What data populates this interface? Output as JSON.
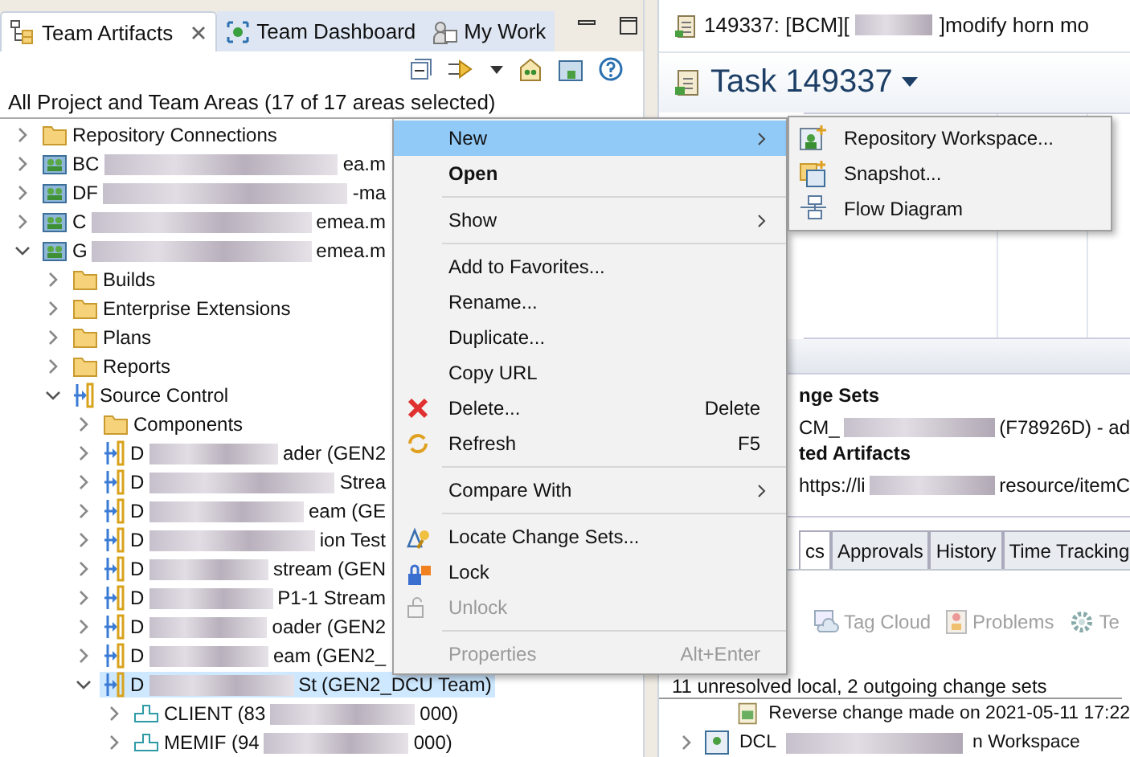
{
  "artifacts_view": {
    "tabs": [
      {
        "label": "Team Artifacts",
        "selected": true
      },
      {
        "label": "Team Dashboard",
        "selected": false
      },
      {
        "label": "My Work",
        "selected": false
      }
    ],
    "filter_label": "All Project and Team Areas (17 of 17 areas selected)",
    "tree": [
      {
        "kind": "folder",
        "label": "Repository Connections",
        "expanded": false,
        "selected": false,
        "blurred": false
      },
      {
        "kind": "project-area",
        "label": "BC",
        "label_end": "ea.m",
        "blurred": true,
        "expanded": false,
        "selected": false
      },
      {
        "kind": "project-area",
        "label": "DF",
        "label_end": "-ma",
        "blurred": true,
        "expanded": false,
        "selected": false
      },
      {
        "kind": "project-area",
        "label": "C",
        "label_end": "emea.m",
        "blurred": true,
        "expanded": false,
        "selected": false
      },
      {
        "kind": "project-area",
        "label": "G",
        "label_end": "emea.m",
        "blurred": true,
        "expanded": true,
        "selected": false,
        "children": [
          {
            "kind": "folder",
            "label": "Builds",
            "expanded": false,
            "selected": false,
            "blurred": false
          },
          {
            "kind": "folder",
            "label": "Enterprise Extensions",
            "expanded": false,
            "selected": false,
            "blurred": false
          },
          {
            "kind": "folder",
            "label": "Plans",
            "expanded": false,
            "selected": false,
            "blurred": false
          },
          {
            "kind": "folder",
            "label": "Reports",
            "expanded": false,
            "selected": false,
            "blurred": false
          },
          {
            "kind": "stream",
            "label": "Source Control",
            "expanded": true,
            "selected": false,
            "blurred": false,
            "children": [
              {
                "kind": "folder",
                "label": "Components",
                "expanded": false,
                "selected": false,
                "blurred": false
              },
              {
                "kind": "stream",
                "label": "D",
                "label_end": "ader (GEN2",
                "blurred": true,
                "expanded": false,
                "selected": false
              },
              {
                "kind": "stream",
                "label": "D",
                "label_end": "Strea",
                "blurred": true,
                "expanded": false,
                "selected": false
              },
              {
                "kind": "stream",
                "label": "D",
                "label_end": "eam (GE",
                "blurred": true,
                "expanded": false,
                "selected": false
              },
              {
                "kind": "stream",
                "label": "D",
                "label_end": "ion Test",
                "blurred": true,
                "expanded": false,
                "selected": false
              },
              {
                "kind": "stream",
                "label": "D",
                "label_end": "stream (GEN",
                "blurred": true,
                "expanded": false,
                "selected": false
              },
              {
                "kind": "stream",
                "label": "D",
                "label_end": "P1-1 Stream",
                "blurred": true,
                "expanded": false,
                "selected": false
              },
              {
                "kind": "stream",
                "label": "D",
                "label_end": "oader (GEN2",
                "blurred": true,
                "expanded": false,
                "selected": false
              },
              {
                "kind": "stream",
                "label": "D",
                "label_end": "eam (GEN2_",
                "blurred": true,
                "expanded": false,
                "selected": false
              },
              {
                "kind": "stream",
                "label": "D",
                "label_end": "St",
                "label_tail": "(GEN2_DCU Team)",
                "blurred": true,
                "expanded": true,
                "selected": true,
                "children": [
                  {
                    "kind": "component",
                    "label": "CLIENT (83",
                    "label_end": "000)",
                    "blurred": true,
                    "expanded": false,
                    "selected": false
                  },
                  {
                    "kind": "component",
                    "label": "MEMIF (94",
                    "label_end": "000)",
                    "blurred": true,
                    "expanded": false,
                    "selected": false
                  }
                ]
              }
            ]
          }
        ]
      }
    ]
  },
  "editor": {
    "tab_title": "149337: [BCM][",
    "tab_title_end": "]modify horn mo",
    "heading": "Task 149337",
    "links": [
      {
        "kind": "heading",
        "text": "nge Sets"
      },
      {
        "kind": "value",
        "text": "CM_",
        "text_end": "(F78926D) - ad"
      },
      {
        "kind": "heading",
        "text": "ted Artifacts"
      },
      {
        "kind": "value",
        "text": "https://li",
        "text_end": "resource/itemC"
      }
    ],
    "tabs": [
      {
        "label": "cs",
        "selected": true
      },
      {
        "label": "Approvals",
        "selected": false
      },
      {
        "label": "History",
        "selected": false
      },
      {
        "label": "Time Tracking",
        "selected": false
      }
    ],
    "toolbar": [
      {
        "label": "Tag Cloud",
        "disabled": true
      },
      {
        "label": "Problems",
        "disabled": true
      },
      {
        "label": "Te",
        "disabled": true
      }
    ],
    "changes_summary": "11 unresolved local, 2 outgoing change sets",
    "change_rows": [
      {
        "kind": "change-set",
        "text": "Reverse change made on 2021-05-11 17:22"
      },
      {
        "kind": "workspace",
        "text": "DCL",
        "text_end": "n Workspace"
      }
    ]
  },
  "context_menu": {
    "items": [
      {
        "kind": "item",
        "label": "New",
        "selected": true,
        "disabled": false,
        "bold": false,
        "submenu": true
      },
      {
        "kind": "item",
        "label": "Open",
        "selected": false,
        "disabled": false,
        "bold": true,
        "submenu": false
      },
      {
        "kind": "separator"
      },
      {
        "kind": "item",
        "label": "Show",
        "selected": false,
        "disabled": false,
        "bold": false,
        "submenu": true
      },
      {
        "kind": "separator"
      },
      {
        "kind": "item",
        "label": "Add to Favorites...",
        "selected": false,
        "disabled": false,
        "bold": false,
        "submenu": false
      },
      {
        "kind": "item",
        "label": "Rename...",
        "selected": false,
        "disabled": false,
        "bold": false,
        "submenu": false
      },
      {
        "kind": "item",
        "label": "Duplicate...",
        "selected": false,
        "disabled": false,
        "bold": false,
        "submenu": false
      },
      {
        "kind": "item",
        "label": "Copy URL",
        "selected": false,
        "disabled": false,
        "bold": false,
        "submenu": false
      },
      {
        "kind": "item",
        "label": "Delete...",
        "shortcut": "Delete",
        "selected": false,
        "disabled": false,
        "bold": false,
        "submenu": false
      },
      {
        "kind": "item",
        "label": "Refresh",
        "shortcut": "F5",
        "selected": false,
        "disabled": false,
        "bold": false,
        "submenu": false
      },
      {
        "kind": "separator"
      },
      {
        "kind": "item",
        "label": "Compare With",
        "selected": false,
        "disabled": false,
        "bold": false,
        "submenu": true
      },
      {
        "kind": "separator"
      },
      {
        "kind": "item",
        "label": "Locate Change Sets...",
        "selected": false,
        "disabled": false,
        "bold": false,
        "submenu": false
      },
      {
        "kind": "item",
        "label": "Lock",
        "selected": false,
        "disabled": false,
        "bold": false,
        "submenu": false
      },
      {
        "kind": "item",
        "label": "Unlock",
        "selected": false,
        "disabled": true,
        "bold": false,
        "submenu": false
      },
      {
        "kind": "separator"
      },
      {
        "kind": "item",
        "label": "Properties",
        "shortcut": "Alt+Enter",
        "selected": false,
        "disabled": true,
        "bold": false,
        "submenu": false
      }
    ]
  },
  "submenu": {
    "items": [
      {
        "label": "Repository Workspace...",
        "selected": false
      },
      {
        "label": "Snapshot...",
        "selected": false
      },
      {
        "label": "Flow Diagram",
        "selected": false
      }
    ]
  }
}
